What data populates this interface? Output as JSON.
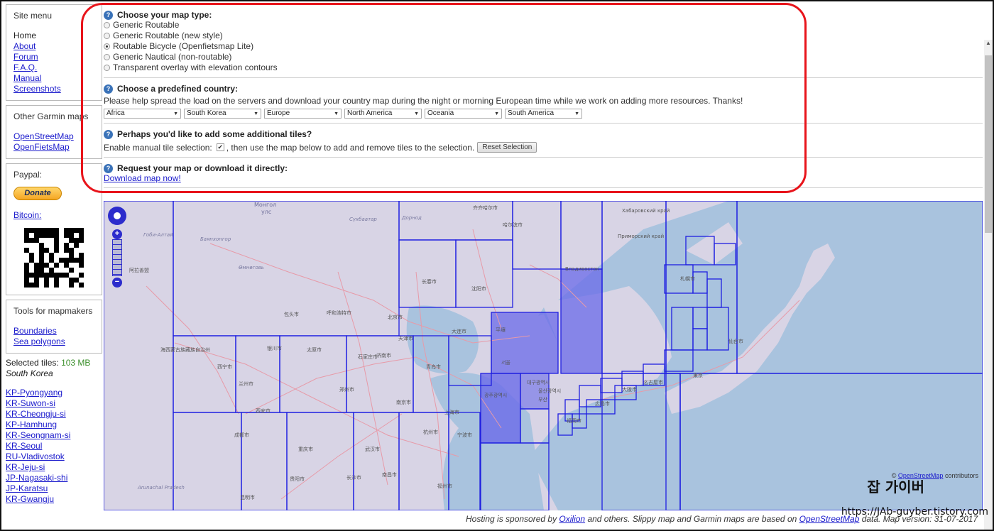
{
  "sidebar": {
    "site_menu": {
      "title": "Site menu",
      "items": [
        "Home",
        "About",
        "Forum",
        "F.A.Q.",
        "Manual",
        "Screenshots"
      ]
    },
    "other_garmin": {
      "title": "Other Garmin maps",
      "items": [
        "OpenStreetMap",
        "OpenFietsMap"
      ]
    },
    "paypal": {
      "title": "Paypal:",
      "donate_label": "Donate",
      "bitcoin_label": "Bitcoin:"
    },
    "tools": {
      "title": "Tools for mapmakers",
      "items": [
        "Boundaries",
        "Sea polygons"
      ]
    },
    "selected_tiles_label": "Selected tiles:",
    "selected_tiles_size": "103 MB",
    "selected_country": "South Korea",
    "tiles": [
      "KP-Pyongyang",
      "KR-Suwon-si",
      "KR-Cheongju-si",
      "KP-Hamhung",
      "KR-Seongnam-si",
      "KR-Seoul",
      "RU-Vladivostok",
      "KR-Jeju-si",
      "JP-Nagasaki-shi",
      "JP-Karatsu",
      "KR-Gwangju"
    ]
  },
  "map_type": {
    "title": "Choose your map type:",
    "options": [
      {
        "label": "Generic Routable",
        "selected": false
      },
      {
        "label": "Generic Routable (new style)",
        "selected": false
      },
      {
        "label": "Routable Bicycle (Openfietsmap Lite)",
        "selected": true
      },
      {
        "label": "Generic Nautical (non-routable)",
        "selected": false
      },
      {
        "label": "Transparent overlay with elevation contours",
        "selected": false
      }
    ]
  },
  "country": {
    "title": "Choose a predefined country:",
    "note": "Please help spread the load on the servers and download your country map during the night or morning European time while we work on adding more resources. Thanks!",
    "selects": [
      "Africa",
      "South Korea",
      "Europe",
      "North America",
      "Oceania",
      "South America"
    ]
  },
  "tiles_section": {
    "title": "Perhaps you'd like to add some additional tiles?",
    "manual_label_before": "Enable manual tile selection:",
    "manual_checked": true,
    "manual_label_after": ", then use the map below to add and remove tiles to the selection.",
    "reset_label": "Reset Selection"
  },
  "request": {
    "title": "Request your map or download it directly:",
    "download_link": "Download map now!"
  },
  "map": {
    "attribution_prefix": "©",
    "attribution_link": "OpenStreetMap",
    "attribution_suffix": "contributors",
    "labels": [
      "Монгол",
      "улс",
      "齐齐哈尔市",
      "哈尔滨市",
      "长春市",
      "沈阳市",
      "北京市",
      "天津市",
      "大连市",
      "石家庄市",
      "太原市",
      "济南市",
      "青岛市",
      "郑州市",
      "西安市",
      "南京市",
      "上海市",
      "武汉市",
      "杭州市",
      "南昌市",
      "长沙市",
      "宁波市",
      "福州市",
      "西宁市",
      "兰州市",
      "银川市",
      "呼和浩特市",
      "包头市",
      "成都市",
      "重庆市",
      "贵阳市",
      "昆明市",
      "平壤",
      "서울",
      "부산",
      "광주광역시",
      "대구광역시",
      "울산광역시",
      "Приморский край",
      "Хабаровский край",
      "札幌市",
      "仙台市",
      "東京",
      "大阪市",
      "名古屋市",
      "福岡市",
      "広島市",
      "Владивосток",
      "阿拉善盟",
      "海西蒙古族藏族自治州",
      "Гоби-Алтай",
      "Баянхонгор",
      "Өмнөговь",
      "Сүхбаатар",
      "Дорнод",
      "Arunachal Pradesh"
    ]
  },
  "watermark": {
    "name": "잡 가이버",
    "url": "https://JAb-guyber.tistory.com"
  },
  "footer": {
    "text_a": "Hosting is sponsored by",
    "link_a": "Oxilion",
    "text_b": "and others. Slippy map and Garmin maps are based on",
    "link_b": "OpenStreetMap",
    "text_c": "data. Map version: 31-07-2017"
  },
  "colors": {
    "highlight": "#e8141b",
    "link": "#1a1acc",
    "tile_border": "#1f1fe0",
    "sea": "#a9c3de",
    "land": "#d8d4e5",
    "selected_tile": "#6b6be8"
  }
}
